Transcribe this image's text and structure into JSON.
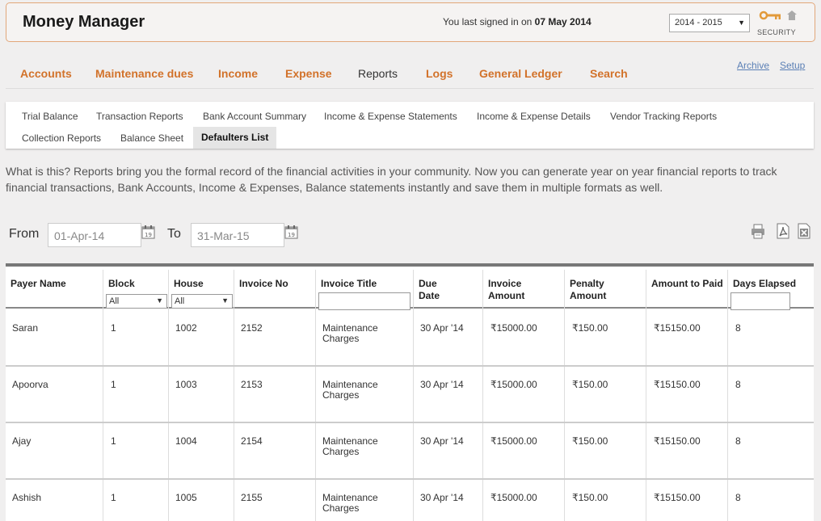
{
  "header": {
    "title": "Money Manager",
    "signin_prefix": "You last signed in on",
    "signin_date": "07 May 2014",
    "year_select": "2014 - 2015",
    "security_label": "SECURITY"
  },
  "nav": {
    "items": [
      {
        "label": "Accounts"
      },
      {
        "label": "Maintenance dues"
      },
      {
        "label": "Income"
      },
      {
        "label": "Expense"
      },
      {
        "label": "Reports"
      },
      {
        "label": "Logs"
      },
      {
        "label": "General Ledger"
      },
      {
        "label": "Search"
      }
    ],
    "active": "Reports",
    "archive": "Archive",
    "setup": "Setup"
  },
  "subnav": {
    "items": [
      {
        "label": "Trial Balance"
      },
      {
        "label": "Transaction Reports"
      },
      {
        "label": "Bank Account Summary"
      },
      {
        "label": "Income & Expense Statements"
      },
      {
        "label": "Income & Expense Details"
      },
      {
        "label": "Vendor Tracking Reports"
      },
      {
        "label": "Collection Reports"
      },
      {
        "label": "Balance Sheet"
      },
      {
        "label": "Defaulters List"
      }
    ],
    "active": "Defaulters List"
  },
  "description": "What is this? Reports bring you the formal record of the financial activities in your community. Now you can generate year on year financial reports to track financial transactions, Bank Accounts, Income & Expenses, Balance statements instantly and save them in multiple formats as well.",
  "filters": {
    "from_label": "From",
    "from_value": "01-Apr-14",
    "to_label": "To",
    "to_value": "31-Mar-15"
  },
  "table": {
    "headers": {
      "payer": "Payer Name",
      "block": "Block",
      "house": "House",
      "invoice_no": "Invoice No",
      "invoice_title": "Invoice Title",
      "due_date_1": "Due",
      "due_date_2": "Date",
      "invoice_amount_1": "Invoice",
      "invoice_amount_2": "Amount",
      "penalty_1": "Penalty",
      "penalty_2": "Amount",
      "amount_to_paid": "Amount to Paid",
      "days_elapsed": "Days Elapsed"
    },
    "block_filter": "All",
    "house_filter": "All",
    "rows": [
      {
        "payer": "Saran",
        "block": "1",
        "house": "1002",
        "invoice_no": "2152",
        "title_1": "Maintenance",
        "title_2": "Charges",
        "due": "30 Apr '14",
        "invoice_amount": "₹15000.00",
        "penalty": "₹150.00",
        "amount": "₹15150.00",
        "days": "8"
      },
      {
        "payer": "Apoorva",
        "block": "1",
        "house": "1003",
        "invoice_no": "2153",
        "title_1": "Maintenance",
        "title_2": "Charges",
        "due": "30 Apr '14",
        "invoice_amount": "₹15000.00",
        "penalty": "₹150.00",
        "amount": "₹15150.00",
        "days": "8"
      },
      {
        "payer": "Ajay",
        "block": "1",
        "house": "1004",
        "invoice_no": "2154",
        "title_1": "Maintenance",
        "title_2": "Charges",
        "due": "30 Apr '14",
        "invoice_amount": "₹15000.00",
        "penalty": "₹150.00",
        "amount": "₹15150.00",
        "days": "8"
      },
      {
        "payer": "Ashish",
        "block": "1",
        "house": "1005",
        "invoice_no": "2155",
        "title_1": "Maintenance",
        "title_2": "Charges",
        "due": "30 Apr '14",
        "invoice_amount": "₹15000.00",
        "penalty": "₹150.00",
        "amount": "₹15150.00",
        "days": "8"
      }
    ]
  },
  "colors": {
    "accent": "#d2722a",
    "link": "#5a7fb5",
    "header_border": "#e2a77a"
  },
  "icons": [
    "key-icon",
    "home-icon",
    "calendar-icon",
    "print-icon",
    "pdf-icon",
    "excel-icon"
  ]
}
